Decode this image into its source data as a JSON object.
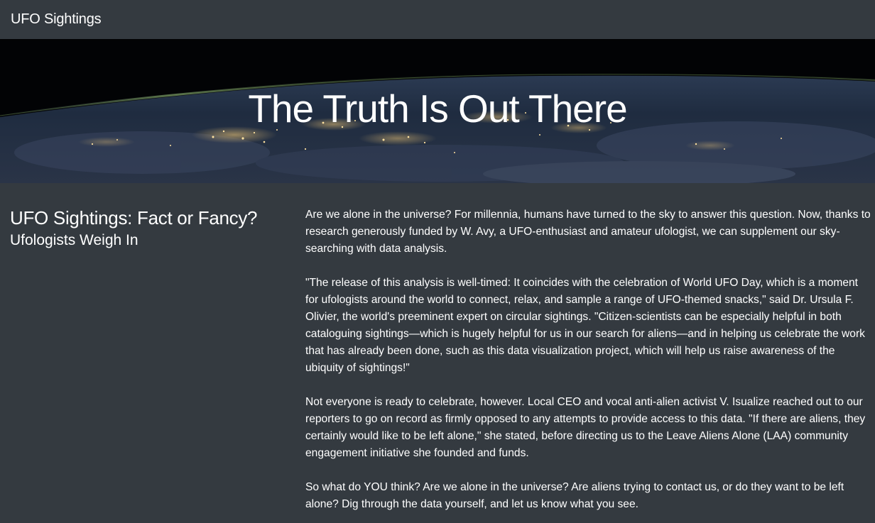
{
  "navbar": {
    "brand": "UFO Sightings"
  },
  "hero": {
    "title": "The Truth Is Out There"
  },
  "sidebar": {
    "title": "UFO Sightings: Fact or Fancy?",
    "subtitle": "Ufologists Weigh In"
  },
  "article": {
    "paragraphs": [
      "Are we alone in the universe? For millennia, humans have turned to the sky to answer this question. Now, thanks to research generously funded by W. Avy, a UFO-enthusiast and amateur ufologist, we can supplement our sky-searching with data analysis.",
      "\"The release of this analysis is well-timed: It coincides with the celebration of World UFO Day, which is a moment for ufologists around the world to connect, relax, and sample a range of UFO-themed snacks,\" said Dr. Ursula F. Olivier, the world's preeminent expert on circular sightings. \"Citizen-scientists can be especially helpful in both cataloguing sightings—which is hugely helpful for us in our search for aliens—and in helping us celebrate the work that has already been done, such as this data visualization project, which will help us raise awareness of the ubiquity of sightings!\"",
      "Not everyone is ready to celebrate, however. Local CEO and vocal anti-alien activist V. Isualize reached out to our reporters to go on record as firmly opposed to any attempts to provide access to this data. \"If there are aliens, they certainly would like to be left alone,\" she stated, before directing us to the Leave Aliens Alone (LAA) community engagement initiative she founded and funds.",
      "So what do YOU think? Are we alone in the universe? Are aliens trying to contact us, or do they want to be left alone? Dig through the data yourself, and let us know what you see."
    ]
  },
  "colors": {
    "background": "#343a40",
    "text": "#ffffff"
  }
}
